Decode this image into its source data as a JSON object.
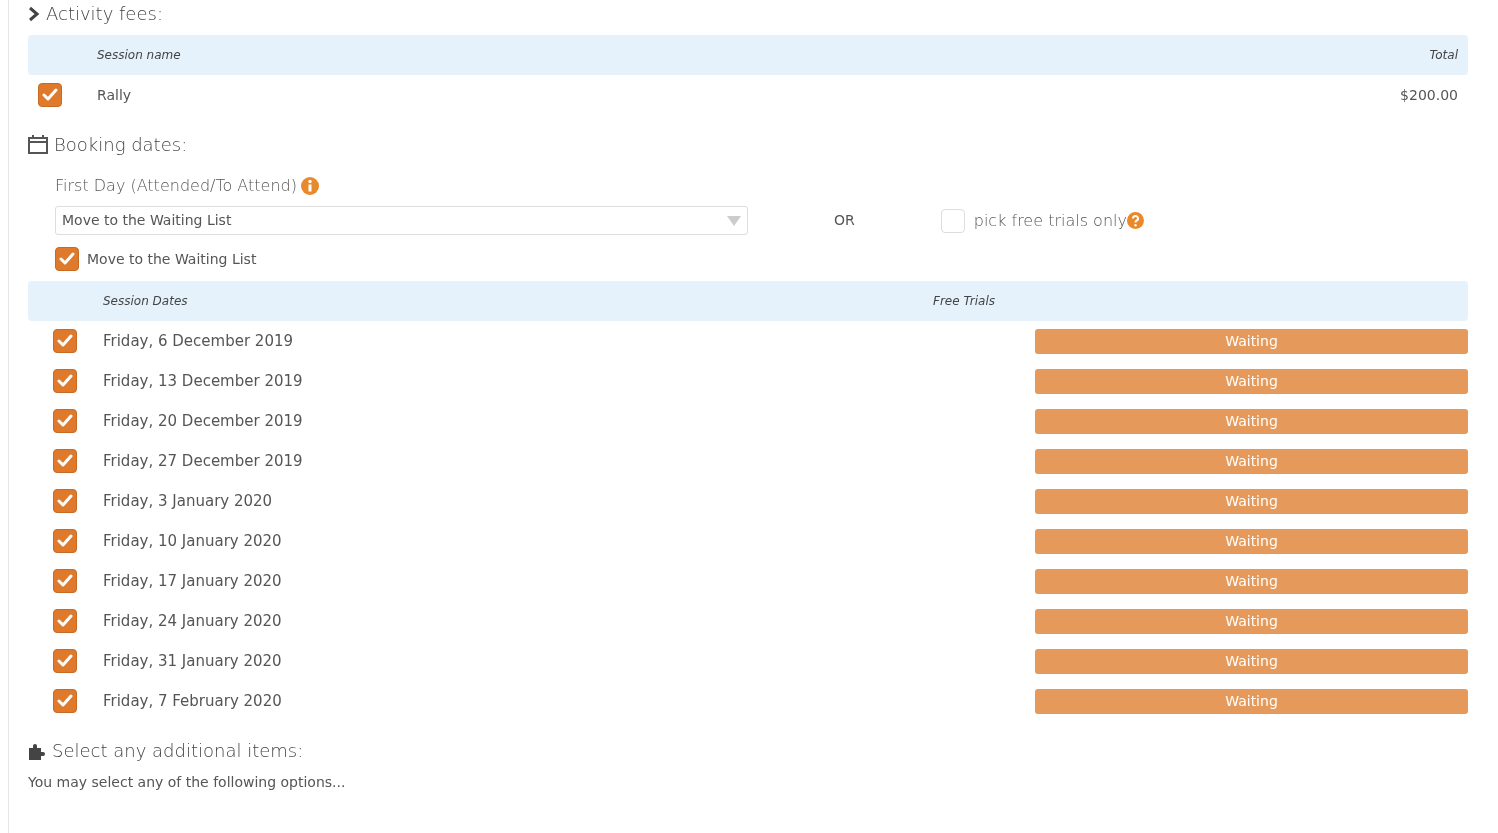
{
  "activity_fees": {
    "title": "Activity fees:",
    "columns": [
      "Session name",
      "Total"
    ],
    "rows": [
      {
        "checked": true,
        "name": "Rally",
        "total": "$200.00"
      }
    ]
  },
  "booking_dates": {
    "title": "Booking dates:",
    "first_day_label": "First Day (Attended/To Attend)",
    "first_day_value": "Move to the Waiting List",
    "or_text": "OR",
    "free_trials": {
      "checked": false,
      "label": "pick free trials only"
    },
    "waiting_list": {
      "checked": true,
      "label": "Move to the Waiting List"
    },
    "columns": [
      "Session Dates",
      "Free Trials"
    ],
    "rows": [
      {
        "checked": true,
        "date": "Friday, 6 December 2019",
        "status": "Waiting"
      },
      {
        "checked": true,
        "date": "Friday, 13 December 2019",
        "status": "Waiting"
      },
      {
        "checked": true,
        "date": "Friday, 20 December 2019",
        "status": "Waiting"
      },
      {
        "checked": true,
        "date": "Friday, 27 December 2019",
        "status": "Waiting"
      },
      {
        "checked": true,
        "date": "Friday, 3 January 2020",
        "status": "Waiting"
      },
      {
        "checked": true,
        "date": "Friday, 10 January 2020",
        "status": "Waiting"
      },
      {
        "checked": true,
        "date": "Friday, 17 January 2020",
        "status": "Waiting"
      },
      {
        "checked": true,
        "date": "Friday, 24 January 2020",
        "status": "Waiting"
      },
      {
        "checked": true,
        "date": "Friday, 31 January 2020",
        "status": "Waiting"
      },
      {
        "checked": true,
        "date": "Friday, 7 February 2020",
        "status": "Waiting"
      }
    ]
  },
  "additional_items": {
    "title": "Select any additional items:",
    "note": "You may select any of the following options..."
  }
}
